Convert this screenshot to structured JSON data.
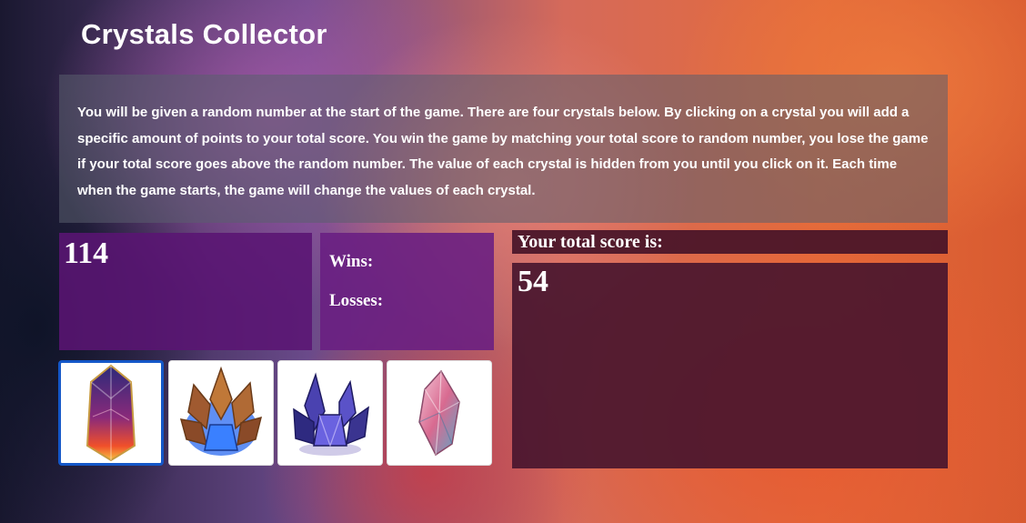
{
  "page": {
    "title": "Crystals Collector",
    "instructions": "You will be given a random number at the start of the game. There are four crystals below. By clicking on a crystal you will add a specific amount of points to your total score. You win the game by matching your total score to random number, you lose the game if your total score goes above the random number. The value of each crystal is hidden from you until you click on it. Each time when the game starts, the game will change the values of each crystal."
  },
  "game": {
    "target_number": "114",
    "wins_label": "Wins:",
    "losses_label": "Losses:",
    "score_label": "Your total score is:",
    "total_score": "54"
  },
  "crystals": [
    {
      "name": "crystal-1-icon",
      "colors": [
        "#3a2a8a",
        "#e0402a",
        "#f8c040"
      ]
    },
    {
      "name": "crystal-2-icon",
      "colors": [
        "#a05a30",
        "#2a6af0",
        "#f0a050"
      ]
    },
    {
      "name": "crystal-3-icon",
      "colors": [
        "#2a2a80",
        "#7060e0",
        "#c0b0ff"
      ]
    },
    {
      "name": "crystal-4-icon",
      "colors": [
        "#e08aa0",
        "#6ab8d0",
        "#f5d0e0"
      ]
    }
  ],
  "theme": {
    "selected_border": "#1457c8"
  }
}
